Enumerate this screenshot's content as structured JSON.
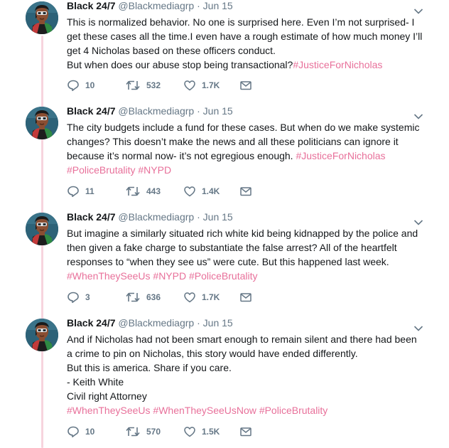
{
  "author": {
    "name": "Black 24/7",
    "handle": "@Blackmediagrp",
    "separator": "·"
  },
  "icons": {
    "reply": "reply-icon",
    "retweet": "retweet-icon",
    "like": "heart-icon",
    "dm": "envelope-icon",
    "menu": "chevron-down-icon"
  },
  "colors": {
    "hashtag": "#e8709a",
    "thread_line": "#f7d4de",
    "muted": "#657786"
  },
  "tweets": [
    {
      "date": "Jun 15",
      "lines": [
        [
          {
            "text": "This is normalized behavior. No one is surprised here. Even I’m not surprised- I"
          }
        ],
        [
          {
            "text": "get these cases all the time.I even have a rough estimate of how much money I’ll"
          }
        ],
        [
          {
            "text": "get 4 Nicholas based on these officers conduct."
          }
        ],
        [
          {
            "text": "But when does our abuse stop being transactional?"
          },
          {
            "text": "#JusticeForNicholas",
            "tag": true
          }
        ]
      ],
      "replies": "10",
      "retweets": "532",
      "likes": "1.7K"
    },
    {
      "date": "Jun 15",
      "lines": [
        [
          {
            "text": "The city budgets include a fund for these cases. But when do we make systemic"
          }
        ],
        [
          {
            "text": "changes? This doesn’t make the news and all these politicians can ignore it"
          }
        ],
        [
          {
            "text": "because it’s normal now- it’s not egregious enough. "
          },
          {
            "text": "#JusticeForNicholas",
            "tag": true
          }
        ],
        [
          {
            "text": "#PoliceBrutality",
            "tag": true
          },
          {
            "text": " "
          },
          {
            "text": "#NYPD",
            "tag": true
          }
        ]
      ],
      "replies": "11",
      "retweets": "443",
      "likes": "1.4K"
    },
    {
      "date": "Jun 15",
      "lines": [
        [
          {
            "text": "But imagine a similarly situated rich white kid being kidnapped by the police and"
          }
        ],
        [
          {
            "text": "then given a fake charge to substantiate the false arrest?  All of the heartfelt"
          }
        ],
        [
          {
            "text": "responses to “when they see us” were cute. But this happened last week."
          }
        ],
        [
          {
            "text": "#WhenTheySeeUs",
            "tag": true
          },
          {
            "text": " "
          },
          {
            "text": "#NYPD",
            "tag": true
          },
          {
            "text": " "
          },
          {
            "text": "#PoliceBrutality",
            "tag": true
          }
        ]
      ],
      "replies": "3",
      "retweets": "636",
      "likes": "1.7K"
    },
    {
      "date": "Jun 15",
      "lines": [
        [
          {
            "text": "And if Nicholas had not been smart enough to remain silent and there had been"
          }
        ],
        [
          {
            "text": "a crime to pin on Nicholas, this story would have ended differently."
          }
        ],
        [
          {
            "text": "But this is america. Share if you care."
          }
        ],
        [
          {
            "text": "- Keith White"
          }
        ],
        [
          {
            "text": "Civil right Attorney"
          }
        ],
        [
          {
            "text": "#WhenTheySeeUs",
            "tag": true
          },
          {
            "text": " "
          },
          {
            "text": "#WhenTheySeeUsNow",
            "tag": true
          },
          {
            "text": " "
          },
          {
            "text": "#PoliceBrutality",
            "tag": true
          }
        ]
      ],
      "replies": "10",
      "retweets": "570",
      "likes": "1.5K"
    }
  ]
}
